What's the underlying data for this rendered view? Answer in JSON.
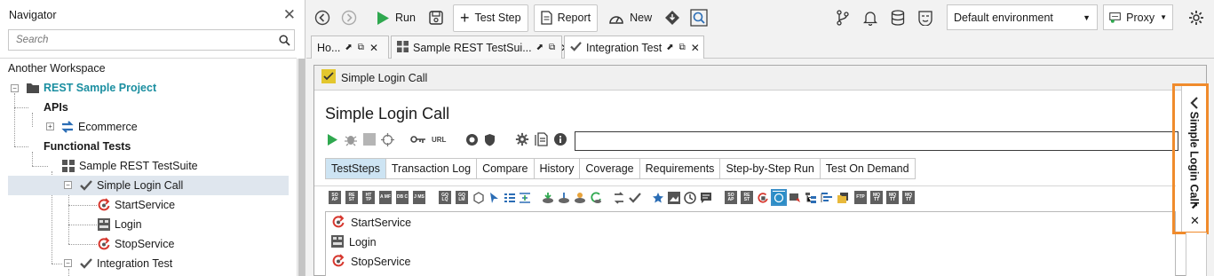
{
  "navigator": {
    "title": "Navigator",
    "search_placeholder": "Search",
    "workspace": "Another Workspace",
    "tree": {
      "project": "REST Sample Project",
      "apis": "APIs",
      "ecommerce": "Ecommerce",
      "functional_tests": "Functional Tests",
      "suite": "Sample REST TestSuite",
      "case_selected": "Simple Login Call",
      "steps": [
        "StartService",
        "Login",
        "StopService"
      ],
      "case2": "Integration Test"
    }
  },
  "toolbar": {
    "run": "Run",
    "test_step": "Test Step",
    "report": "Report",
    "new": "New",
    "environment": "Default environment",
    "proxy": "Proxy"
  },
  "doc_tabs": [
    {
      "label": "Ho..."
    },
    {
      "label": "Sample REST TestSui..."
    },
    {
      "label": "Integration Test"
    }
  ],
  "editor": {
    "window_title": "Simple Login Call",
    "heading": "Simple Login Call",
    "url_icon_text": "URL",
    "tabs": [
      "TestSteps",
      "Transaction Log",
      "Compare",
      "History",
      "Coverage",
      "Requirements",
      "Step-by-Step Run",
      "Test On Demand"
    ],
    "steps": [
      "StartService",
      "Login",
      "StopService"
    ],
    "side_panel_label": "Simple Login Call"
  },
  "step_tool_labels": [
    "SO AP",
    "RE ST",
    "HT TP",
    "A MF",
    "DB C",
    "J MS",
    "GQ LQ",
    "GQ LM",
    "SO AP",
    "RE ST",
    "FTP",
    "MQ TT",
    "MQ TT",
    "MQ TT"
  ],
  "colors": {
    "accent_orange": "#f08b2c",
    "active_tab": "#cde4f3",
    "run_green": "#2fa84f",
    "project_teal": "#1a8ea0"
  }
}
